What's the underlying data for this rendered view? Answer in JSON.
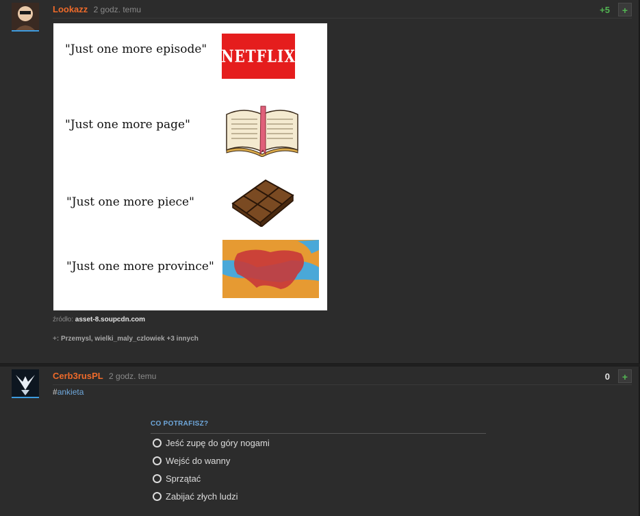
{
  "entry1": {
    "author": "Lookazz",
    "time": "2 godz. temu",
    "score": "+5",
    "vote_label": "+",
    "meme": {
      "lines": [
        "\"Just one more episode\"",
        "\"Just one more page\"",
        "\"Just one more piece\"",
        "\"Just one more province\""
      ],
      "netflix_logo": "NETFLIX"
    },
    "source_label": "źródło:",
    "source_value": "asset-8.soupcdn.com",
    "plus_prefix": "+:",
    "plus_users": "Przemysl, wielki_maly_czlowiek +3 innych"
  },
  "entry2": {
    "author": "Cerb3rusPL",
    "time": "2 godz. temu",
    "score": "0",
    "vote_label": "+",
    "hash": "#",
    "tag": "ankieta",
    "poll": {
      "title": "CO POTRAFISZ?",
      "options": [
        "Jeść zupę do góry nogami",
        "Wejść do wanny",
        "Sprzątać",
        "Zabijać złych ludzi"
      ]
    }
  },
  "colors": {
    "author": "#ee6a2a",
    "link": "#6fa8dc",
    "plus_green": "#52b452",
    "background": "#2c2c2c"
  }
}
